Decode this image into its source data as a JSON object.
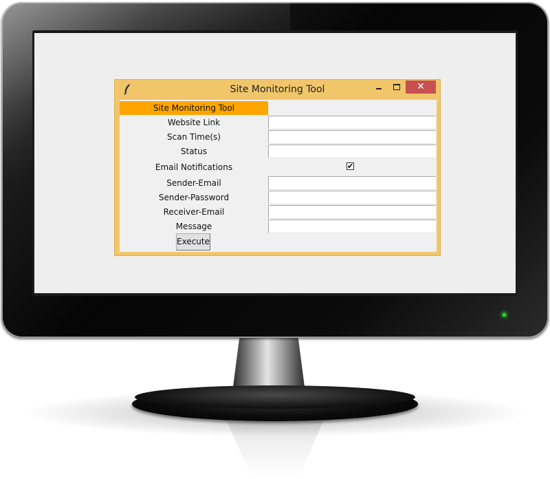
{
  "window": {
    "title": "Site Monitoring Tool",
    "icon": "feather-icon",
    "close_glyph": "✕"
  },
  "form": {
    "heading": "Site Monitoring Tool",
    "website_link_label": "Website Link",
    "website_link_value": "",
    "scan_time_label": "Scan Time(s)",
    "scan_time_value": "",
    "status_label": "Status",
    "status_value": "",
    "email_notifications_label": "Email Notifications",
    "email_notifications_checked": true,
    "check_glyph": "✔",
    "sender_email_label": "Sender-Email",
    "sender_email_value": "",
    "sender_password_label": "Sender-Password",
    "sender_password_value": "",
    "receiver_email_label": "Receiver-Email",
    "receiver_email_value": "",
    "message_label": "Message",
    "message_value": "",
    "execute_label": "Execute"
  },
  "colors": {
    "window_frame": "#f1c66b",
    "heading_background": "#ffa500",
    "close_button": "#c75050",
    "power_led": "#22dd22"
  }
}
